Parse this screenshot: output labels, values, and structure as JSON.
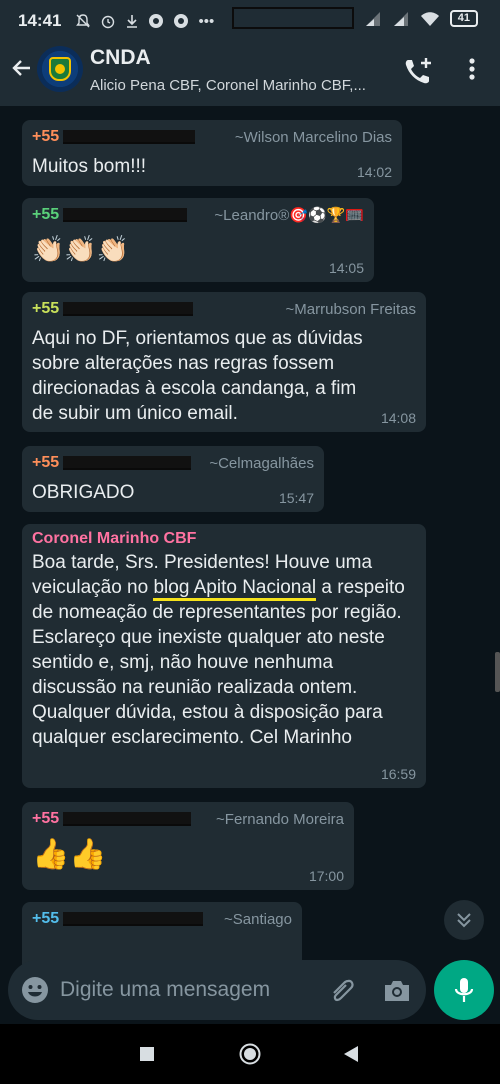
{
  "status_bar": {
    "time": "14:41",
    "icons_left": [
      "mute-bell-icon",
      "alarm-icon",
      "download-icon",
      "chrome-icon",
      "chrome-icon",
      "more-dots-icon"
    ],
    "battery": "41"
  },
  "header": {
    "title": "CNDA",
    "subtitle": "Alicio Pena CBF, Coronel Marinho CBF,..."
  },
  "messages": [
    {
      "phone": "+55",
      "phone_color": "#ff8f5a",
      "pushname": "~Wilson Marcelino Dias",
      "text": "Muitos bom!!!",
      "time": "14:02"
    },
    {
      "phone": "+55",
      "phone_color": "#5ad07a",
      "pushname": "~Leandro®🎯⚽🏆🥅",
      "text": "👏🏻👏🏻👏🏻",
      "time": "14:05"
    },
    {
      "phone": "+55",
      "phone_color": "#c8e05a",
      "pushname": "~Marrubson Freitas",
      "text": "Aqui no DF, orientamos que as dúvidas sobre alterações nas regras fossem direcionadas à escola candanga, a fim de subir um único email.",
      "time": "14:08"
    },
    {
      "phone": "+55",
      "phone_color": "#ff8f5a",
      "pushname": "~Celmagalhães",
      "text": "OBRIGADO",
      "time": "15:47"
    },
    {
      "sender": "Coronel Marinho CBF",
      "sender_color": "#ff72a1",
      "text_parts": [
        "Boa tarde, Srs. Presidentes! Houve uma veiculação no ",
        "blog Apito Nacional",
        " a respeito de nomeação de representantes por região. Esclareço que inexiste qualquer ato neste sentido e, smj, não houve nenhuma discussão na reunião realizada ontem. Qualquer dúvida, estou à disposição para qualquer esclarecimento. Cel Marinho"
      ],
      "time": "16:59"
    },
    {
      "phone": "+55",
      "phone_color": "#ff72a1",
      "pushname": "~Fernando Moreira",
      "text": "👍👍",
      "time": "17:00"
    },
    {
      "phone": "+55",
      "phone_color": "#53bdeb",
      "pushname": "~Santiago",
      "text": "",
      "time": ""
    }
  ],
  "composer": {
    "placeholder": "Digite uma mensagem"
  },
  "colors": {
    "app_bar": "#1f2c34",
    "chat_bg": "#0b141a",
    "bubble": "#202c33",
    "accent": "#00a884",
    "highlight_underline": "#f5e21b"
  }
}
